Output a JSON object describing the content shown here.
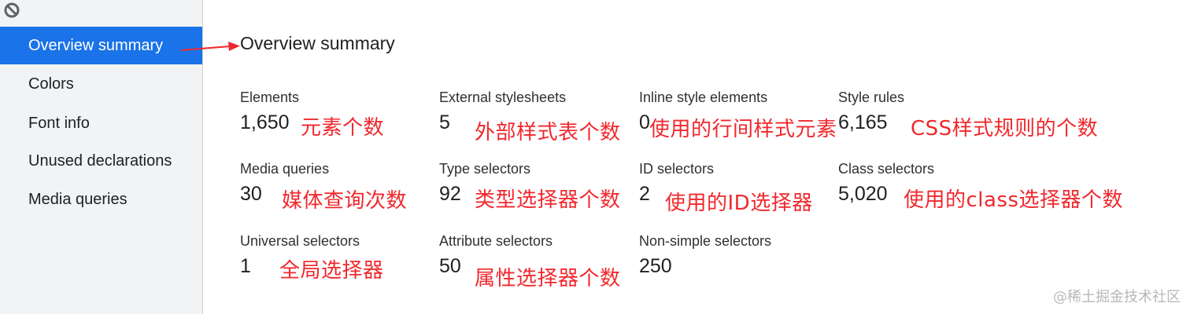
{
  "sidebar": {
    "items": [
      {
        "label": "Overview summary",
        "selected": true
      },
      {
        "label": "Colors"
      },
      {
        "label": "Font info"
      },
      {
        "label": "Unused declarations"
      },
      {
        "label": "Media queries"
      }
    ]
  },
  "main": {
    "title": "Overview summary",
    "metrics": [
      {
        "label": "Elements",
        "value": "1,650"
      },
      {
        "label": "External stylesheets",
        "value": "5"
      },
      {
        "label": "Inline style elements",
        "value": "0"
      },
      {
        "label": "Style rules",
        "value": "6,165"
      },
      {
        "label": "Media queries",
        "value": "30"
      },
      {
        "label": "Type selectors",
        "value": "92"
      },
      {
        "label": "ID selectors",
        "value": "2"
      },
      {
        "label": "Class selectors",
        "value": "5,020"
      },
      {
        "label": "Universal selectors",
        "value": "1"
      },
      {
        "label": "Attribute selectors",
        "value": "50"
      },
      {
        "label": "Non-simple selectors",
        "value": "250"
      }
    ]
  },
  "annotations": [
    "元素个数",
    "外部样式表个数",
    "使用的行间样式元素",
    "CSS样式规则的个数",
    "媒体查询次数",
    "类型选择器个数",
    "使用的ID选择器",
    "使用的class选择器个数",
    "全局选择器",
    "属性选择器个数"
  ],
  "watermark": "@稀土掘金技术社区",
  "colors": {
    "accent": "#1a73e8",
    "annotation": "#f0282d",
    "sidebar_bg": "#f1f3f4"
  },
  "icons": {
    "top_left": "block-icon",
    "arrow": "arrow-icon"
  }
}
